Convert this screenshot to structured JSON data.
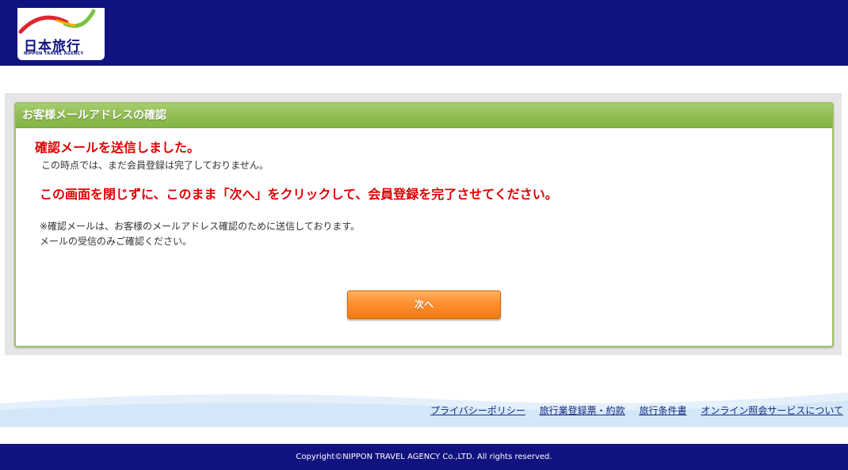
{
  "header": {
    "logo_text": "日本旅行",
    "logo_subtext": "NIPPON TRAVEL AGENCY"
  },
  "panel": {
    "title": "お客様メールアドレスの確認",
    "sent_message": "確認メールを送信しました。",
    "not_complete_message": "この時点では、まだ会員登録は完了しておりません。",
    "instruction": "この画面を閉じずに、このまま「次へ」をクリックして、会員登録を完了させてください。",
    "note_line1": "※確認メールは、お客様のメールアドレス確認のために送信しております。",
    "note_line2": "メールの受信のみご確認ください。",
    "next_button_label": "次へ"
  },
  "footer": {
    "links": [
      "プライバシーポリシー",
      "旅行業登録票・約款",
      "旅行条件書",
      "オンライン照会サービスについて"
    ],
    "copyright": "Copyright©NIPPON TRAVEL AGENCY Co.,LTD. All rights reserved."
  },
  "colors": {
    "header_bg": "#10137f",
    "panel_header": "#8fbb52",
    "alert_red": "#e00000",
    "button_orange": "#ff9030"
  }
}
